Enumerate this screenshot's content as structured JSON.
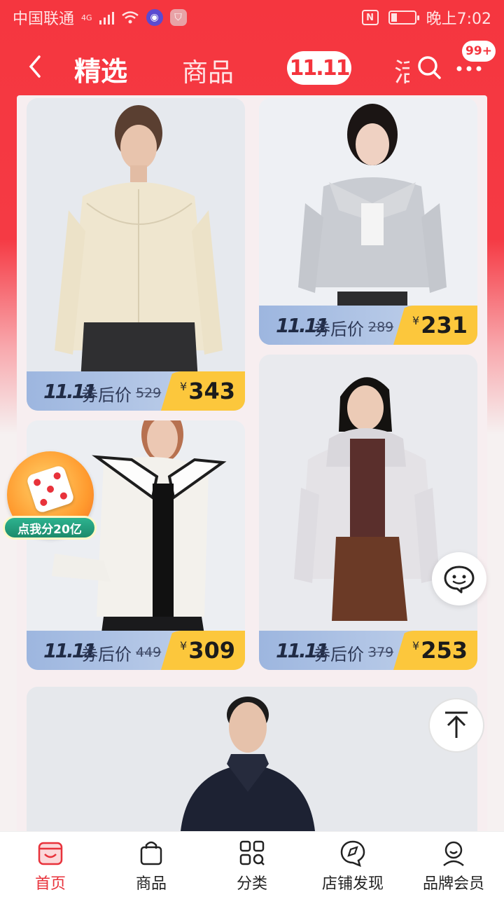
{
  "status_bar": {
    "carrier": "中国联通",
    "network": "4G",
    "time": "晚上7:02"
  },
  "nav": {
    "tabs": [
      {
        "label": "精选",
        "active": true
      },
      {
        "label": "商品",
        "active": false
      },
      {
        "label": "11.11",
        "active": false
      },
      {
        "label": "活",
        "active": false
      }
    ],
    "message_badge": "99+",
    "icons": [
      "back-icon",
      "search-icon",
      "more-icon"
    ]
  },
  "products": [
    {
      "event": "11.11",
      "coupon_label": "券后价",
      "original_price": "529",
      "currency": "¥",
      "final_price": "343"
    },
    {
      "event": "11.11",
      "coupon_label": "券后价",
      "original_price": "289",
      "currency": "¥",
      "final_price": "231"
    },
    {
      "event": "11.11",
      "coupon_label": "券后价",
      "original_price": "449",
      "currency": "¥",
      "final_price": "309"
    },
    {
      "event": "11.11",
      "coupon_label": "券后价",
      "original_price": "379",
      "currency": "¥",
      "final_price": "253"
    }
  ],
  "float_promo": {
    "label": "点我分20亿"
  },
  "tabbar": {
    "items": [
      {
        "label": "首页",
        "icon": "shop-home-icon",
        "active": true
      },
      {
        "label": "商品",
        "icon": "shopping-bag-icon",
        "active": false
      },
      {
        "label": "分类",
        "icon": "category-grid-icon",
        "active": false
      },
      {
        "label": "店铺发现",
        "icon": "discover-chat-icon",
        "active": false
      },
      {
        "label": "品牌会员",
        "icon": "member-icon",
        "active": false
      }
    ]
  },
  "colors": {
    "brand_red": "#f4343d",
    "price_yellow": "#fcc73c",
    "price_strip_blue": "#9db6df"
  }
}
